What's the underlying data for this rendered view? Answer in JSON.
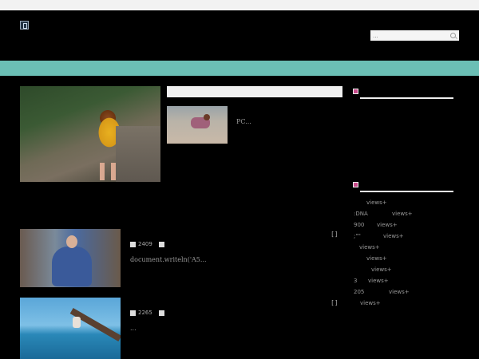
{
  "header": {
    "search_placeholder": "..."
  },
  "main": {
    "featured_snippet": "PC...",
    "posts": [
      {
        "views": "2409",
        "snippet": "document.writeln('A5...",
        "bracket": "[]"
      },
      {
        "views": "2265",
        "snippet": "...",
        "bracket": "[]"
      }
    ]
  },
  "sidebar": {
    "view_items": [
      {
        "prefix": "",
        "suffix": "views+"
      },
      {
        "prefix": ":DNA",
        "suffix": "views+"
      },
      {
        "prefix": "900",
        "suffix": "views+"
      },
      {
        "prefix": ";\"\"",
        "suffix": "views+"
      },
      {
        "prefix": "",
        "suffix": "views+"
      },
      {
        "prefix": "",
        "suffix": "views+"
      },
      {
        "prefix": "",
        "suffix": "views+"
      },
      {
        "prefix": "3",
        "suffix": "views+"
      },
      {
        "prefix": "205",
        "suffix": "views+"
      },
      {
        "prefix": "",
        "suffix": "views+"
      }
    ]
  },
  "colors": {
    "nav": "#6bbfb5",
    "accent_icon": "#c84a8a",
    "background": "#000000"
  },
  "icons": [
    "logo-icon",
    "search-icon",
    "views-icon",
    "comment-icon",
    "widget-icon"
  ]
}
